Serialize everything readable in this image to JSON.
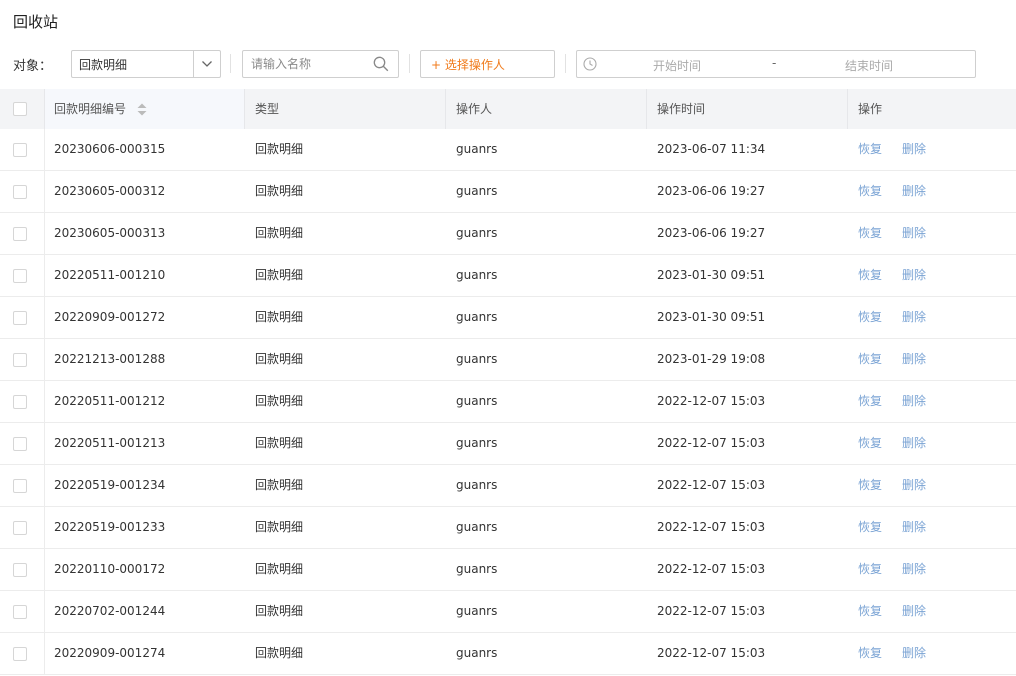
{
  "page": {
    "title": "回收站"
  },
  "filters": {
    "object_label": "对象：",
    "object_value": "回款明细",
    "search_placeholder": "请输入名称",
    "operator_button": "+ 选择操作人",
    "start_placeholder": "开始时间",
    "range_separator": "-",
    "end_placeholder": "结束时间"
  },
  "table": {
    "columns": [
      "回款明细编号",
      "类型",
      "操作人",
      "操作时间",
      "操作"
    ],
    "actions": {
      "restore": "恢复",
      "delete": "删除"
    },
    "rows": [
      {
        "id": "20230606-000315",
        "type": "回款明细",
        "operator": "guanrs",
        "time": "2023-06-07 11:34"
      },
      {
        "id": "20230605-000312",
        "type": "回款明细",
        "operator": "guanrs",
        "time": "2023-06-06 19:27"
      },
      {
        "id": "20230605-000313",
        "type": "回款明细",
        "operator": "guanrs",
        "time": "2023-06-06 19:27"
      },
      {
        "id": "20220511-001210",
        "type": "回款明细",
        "operator": "guanrs",
        "time": "2023-01-30 09:51"
      },
      {
        "id": "20220909-001272",
        "type": "回款明细",
        "operator": "guanrs",
        "time": "2023-01-30 09:51"
      },
      {
        "id": "20221213-001288",
        "type": "回款明细",
        "operator": "guanrs",
        "time": "2023-01-29 19:08"
      },
      {
        "id": "20220511-001212",
        "type": "回款明细",
        "operator": "guanrs",
        "time": "2022-12-07 15:03"
      },
      {
        "id": "20220511-001213",
        "type": "回款明细",
        "operator": "guanrs",
        "time": "2022-12-07 15:03"
      },
      {
        "id": "20220519-001234",
        "type": "回款明细",
        "operator": "guanrs",
        "time": "2022-12-07 15:03"
      },
      {
        "id": "20220519-001233",
        "type": "回款明细",
        "operator": "guanrs",
        "time": "2022-12-07 15:03"
      },
      {
        "id": "20220110-000172",
        "type": "回款明细",
        "operator": "guanrs",
        "time": "2022-12-07 15:03"
      },
      {
        "id": "20220702-001244",
        "type": "回款明细",
        "operator": "guanrs",
        "time": "2022-12-07 15:03"
      },
      {
        "id": "20220909-001274",
        "type": "回款明细",
        "operator": "guanrs",
        "time": "2022-12-07 15:03"
      }
    ]
  },
  "colors": {
    "accent_orange": "#f07a1a",
    "link_blue": "#7aa3d4",
    "header_bg": "#f3f4f6"
  },
  "icons": {
    "select_arrow": "chevron-down-icon",
    "search": "search-icon",
    "date": "clock-icon",
    "sort": "sort-icon"
  }
}
